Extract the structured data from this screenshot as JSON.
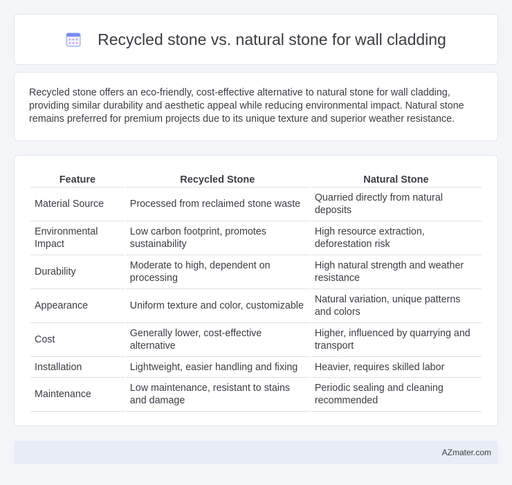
{
  "header": {
    "title": "Recycled stone vs. natural stone for wall cladding",
    "icon": "calendar-grid-icon",
    "icon_color": "#7c8cf0"
  },
  "summary": {
    "text": "Recycled stone offers an eco-friendly, cost-effective alternative to natural stone for wall cladding, providing similar durability and aesthetic appeal while reducing environmental impact. Natural stone remains preferred for premium projects due to its unique texture and superior weather resistance."
  },
  "table": {
    "headers": [
      "Feature",
      "Recycled Stone",
      "Natural Stone"
    ],
    "rows": [
      [
        "Material Source",
        "Processed from reclaimed stone waste",
        "Quarried directly from natural deposits"
      ],
      [
        "Environmental Impact",
        "Low carbon footprint, promotes sustainability",
        "High resource extraction, deforestation risk"
      ],
      [
        "Durability",
        "Moderate to high, dependent on processing",
        "High natural strength and weather resistance"
      ],
      [
        "Appearance",
        "Uniform texture and color, customizable",
        "Natural variation, unique patterns and colors"
      ],
      [
        "Cost",
        "Generally lower, cost-effective alternative",
        "Higher, influenced by quarrying and transport"
      ],
      [
        "Installation",
        "Lightweight, easier handling and fixing",
        "Heavier, requires skilled labor"
      ],
      [
        "Maintenance",
        "Low maintenance, resistant to stains and damage",
        "Periodic sealing and cleaning recommended"
      ]
    ]
  },
  "footer": {
    "brand": "AZmater.com"
  }
}
